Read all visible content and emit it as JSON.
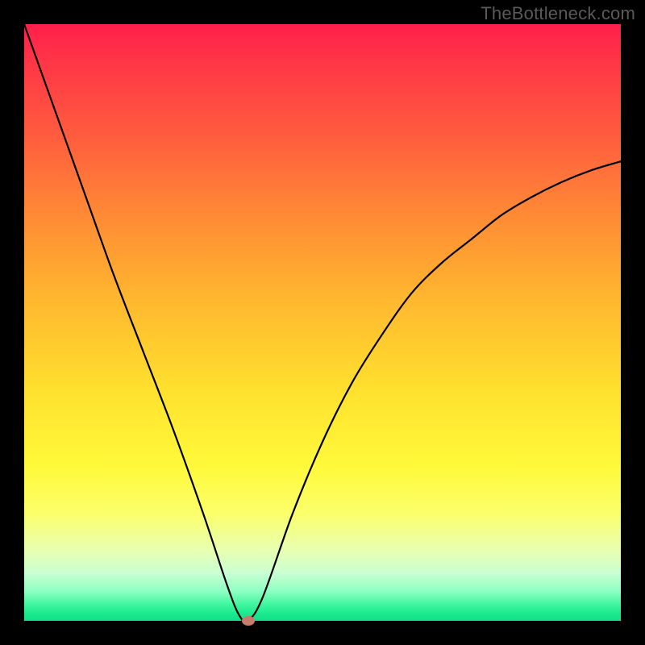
{
  "watermark": "TheBottleneck.com",
  "chart_data": {
    "type": "line",
    "title": "",
    "xlabel": "",
    "ylabel": "",
    "xlim": [
      0,
      100
    ],
    "ylim": [
      0,
      100
    ],
    "grid": false,
    "legend": false,
    "series": [
      {
        "name": "bottleneck-curve",
        "x": [
          0,
          5,
          10,
          15,
          20,
          25,
          30,
          34,
          36,
          37.5,
          40,
          45,
          50,
          55,
          60,
          65,
          70,
          75,
          80,
          85,
          90,
          95,
          100
        ],
        "y": [
          100,
          86,
          72,
          58,
          45,
          32,
          18,
          6,
          1,
          0,
          4,
          18,
          30,
          40,
          48,
          55,
          60,
          64,
          68,
          71,
          73.5,
          75.5,
          77
        ],
        "color": "#000000"
      }
    ],
    "gradient_colors": {
      "top": "#ff1f4b",
      "upper_mid": "#ffb72f",
      "mid": "#fff93a",
      "lower_mid": "#c9ffd2",
      "bottom": "#0fdf87"
    },
    "marker": {
      "x": 37.5,
      "y": 0,
      "color": "#c77b6a"
    }
  }
}
